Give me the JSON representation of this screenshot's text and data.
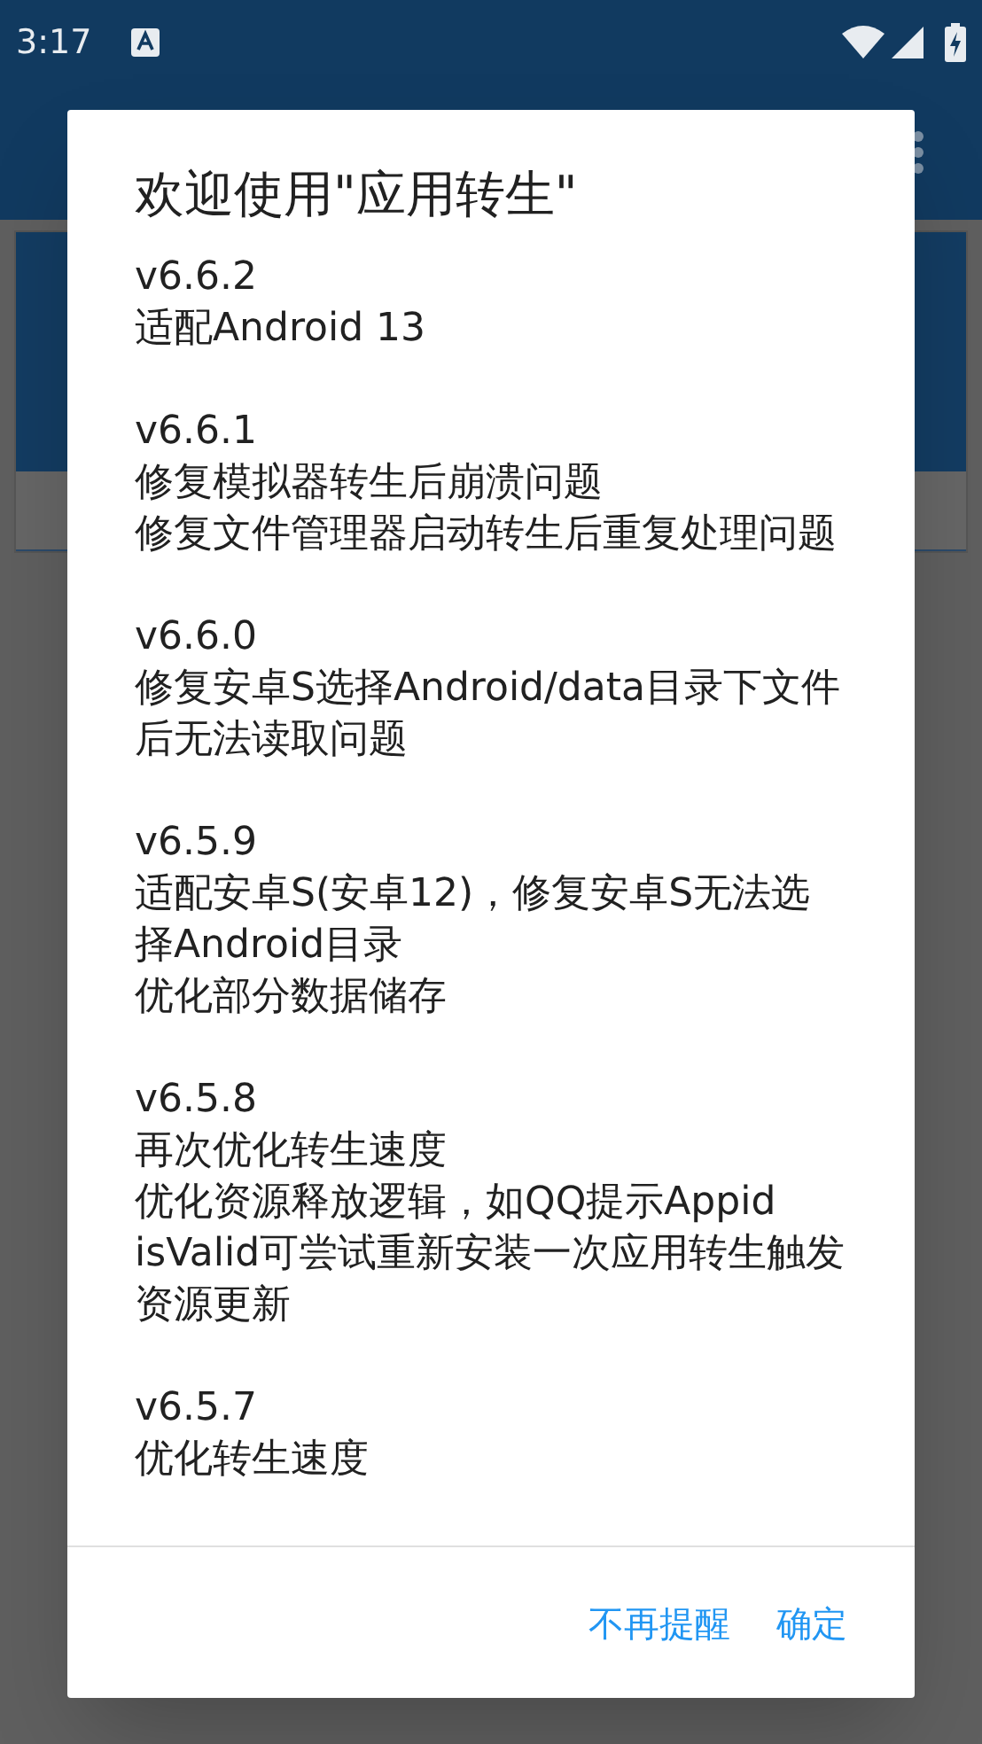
{
  "status_bar": {
    "time": "3:17"
  },
  "dialog": {
    "title": "欢迎使用\"应用转生\"",
    "entries": [
      {
        "version": "v6.6.2",
        "lines": [
          "适配Android 13"
        ]
      },
      {
        "version": "v6.6.1",
        "lines": [
          "修复模拟器转生后崩溃问题",
          "修复文件管理器启动转生后重复处理问题"
        ]
      },
      {
        "version": "v6.6.0",
        "lines": [
          "修复安卓S选择Android/data目录下文件后无法读取问题"
        ]
      },
      {
        "version": "v6.5.9",
        "lines": [
          "适配安卓S(安卓12)，修复安卓S无法选择Android目录",
          "优化部分数据储存"
        ]
      },
      {
        "version": "v6.5.8",
        "lines": [
          "再次优化转生速度",
          "优化资源释放逻辑，如QQ提示Appid isValid可尝试重新安装一次应用转生触发资源更新"
        ]
      },
      {
        "version": "v6.5.7",
        "lines": [
          "优化转生速度"
        ]
      }
    ],
    "buttons": [
      "不再提醒",
      "确定"
    ]
  }
}
